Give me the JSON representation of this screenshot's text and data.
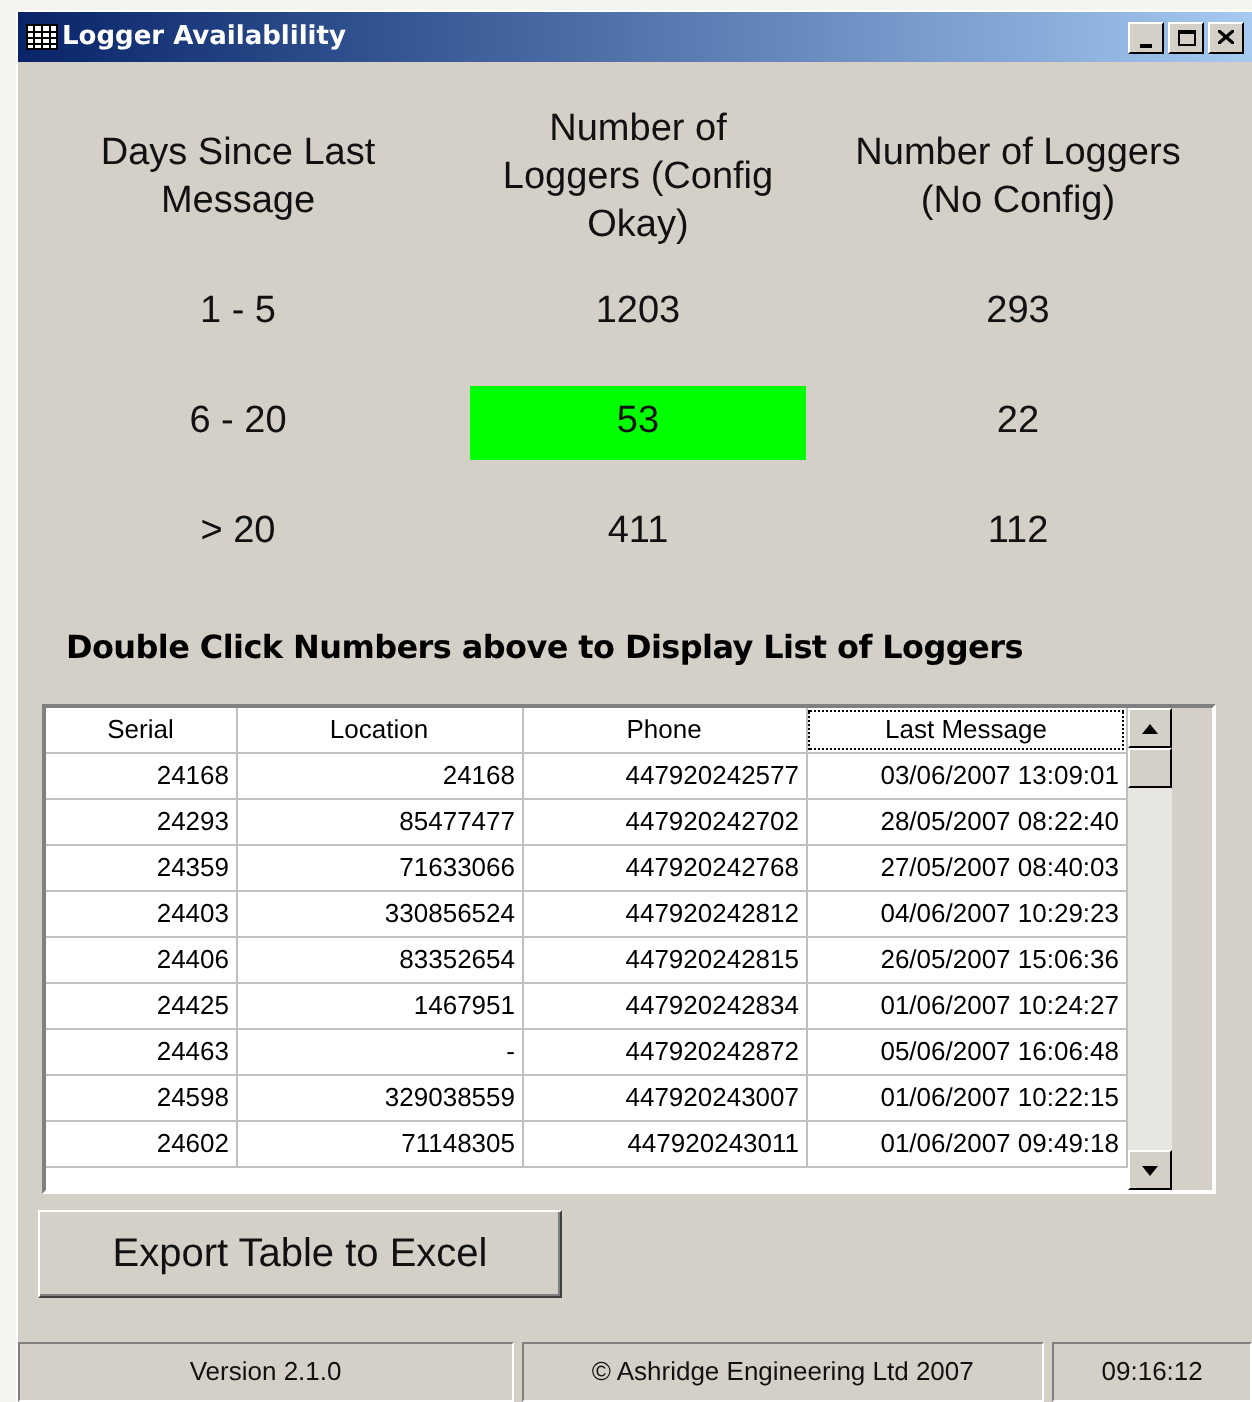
{
  "window": {
    "title": "Logger Availablility"
  },
  "summary": {
    "headers": [
      "Days Since Last Message",
      "Number of Loggers (Config Okay)",
      "Number of Loggers (No Config)"
    ],
    "rows": [
      {
        "range": "1 - 5",
        "values": [
          {
            "text": "1203",
            "highlighted": false
          },
          {
            "text": "293",
            "highlighted": false
          }
        ]
      },
      {
        "range": "6 - 20",
        "values": [
          {
            "text": "53",
            "highlighted": true
          },
          {
            "text": "22",
            "highlighted": false
          }
        ]
      },
      {
        "range": "> 20",
        "values": [
          {
            "text": "411",
            "highlighted": false
          },
          {
            "text": "112",
            "highlighted": false
          }
        ]
      }
    ]
  },
  "instruction": "Double Click Numbers above to Display List of Loggers",
  "table": {
    "columns": [
      {
        "label": "Serial",
        "focused": false
      },
      {
        "label": "Location",
        "focused": false
      },
      {
        "label": "Phone",
        "focused": false
      },
      {
        "label": "Last Message",
        "focused": true
      }
    ],
    "rows": [
      [
        "24168",
        "24168",
        "447920242577",
        "03/06/2007 13:09:01"
      ],
      [
        "24293",
        "85477477",
        "447920242702",
        "28/05/2007 08:22:40"
      ],
      [
        "24359",
        "71633066",
        "447920242768",
        "27/05/2007 08:40:03"
      ],
      [
        "24403",
        "330856524",
        "447920242812",
        "04/06/2007 10:29:23"
      ],
      [
        "24406",
        "83352654",
        "447920242815",
        "26/05/2007 15:06:36"
      ],
      [
        "24425",
        "1467951",
        "447920242834",
        "01/06/2007 10:24:27"
      ],
      [
        "24463",
        "-",
        "447920242872",
        "05/06/2007 16:06:48"
      ],
      [
        "24598",
        "329038559",
        "447920243007",
        "01/06/2007 10:22:15"
      ],
      [
        "24602",
        "71148305",
        "447920243011",
        "01/06/2007 09:49:18"
      ]
    ]
  },
  "export_button": "Export Table to Excel",
  "status_bar": [
    "Version 2.1.0",
    "© Ashridge Engineering Ltd 2007",
    "09:16:12"
  ]
}
